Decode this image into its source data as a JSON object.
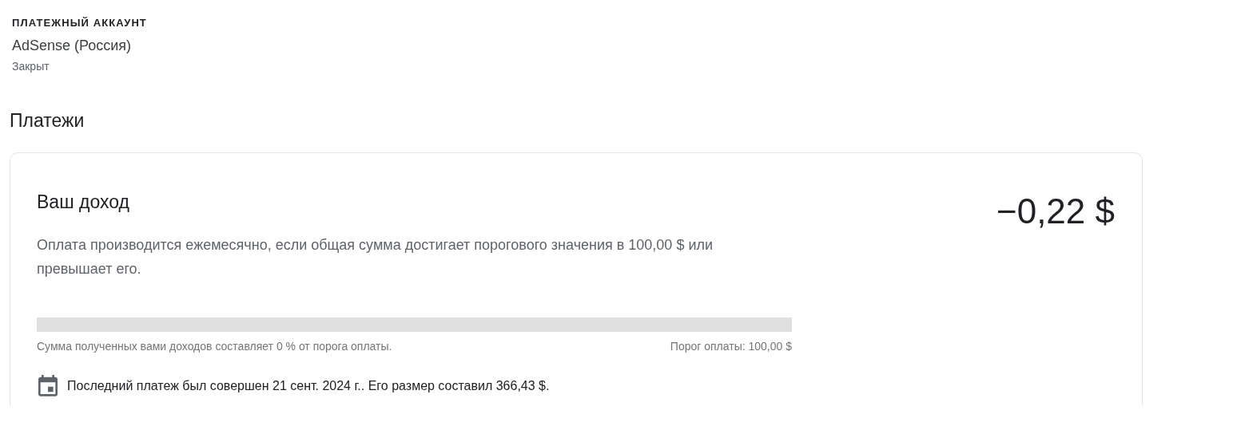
{
  "account": {
    "label": "ПЛАТЕЖНЫЙ АККАУНТ",
    "name": "AdSense (Россия)",
    "status": "Закрыт"
  },
  "section_title": "Платежи",
  "income_card": {
    "title": "Ваш доход",
    "amount": "−0,22 $",
    "description": "Оплата производится ежемесячно, если общая сумма достигает порогового значения в 100,00 $ или превышает его.",
    "progress": {
      "level": 0,
      "caption": "Сумма полученных вами доходов составляет 0 % от порога оплаты.",
      "threshold": "Порог оплаты: 100,00 $"
    },
    "last_payment": "Последний платеж был совершен 21 сент. 2024 г.. Его размер составил 366,43 $."
  }
}
